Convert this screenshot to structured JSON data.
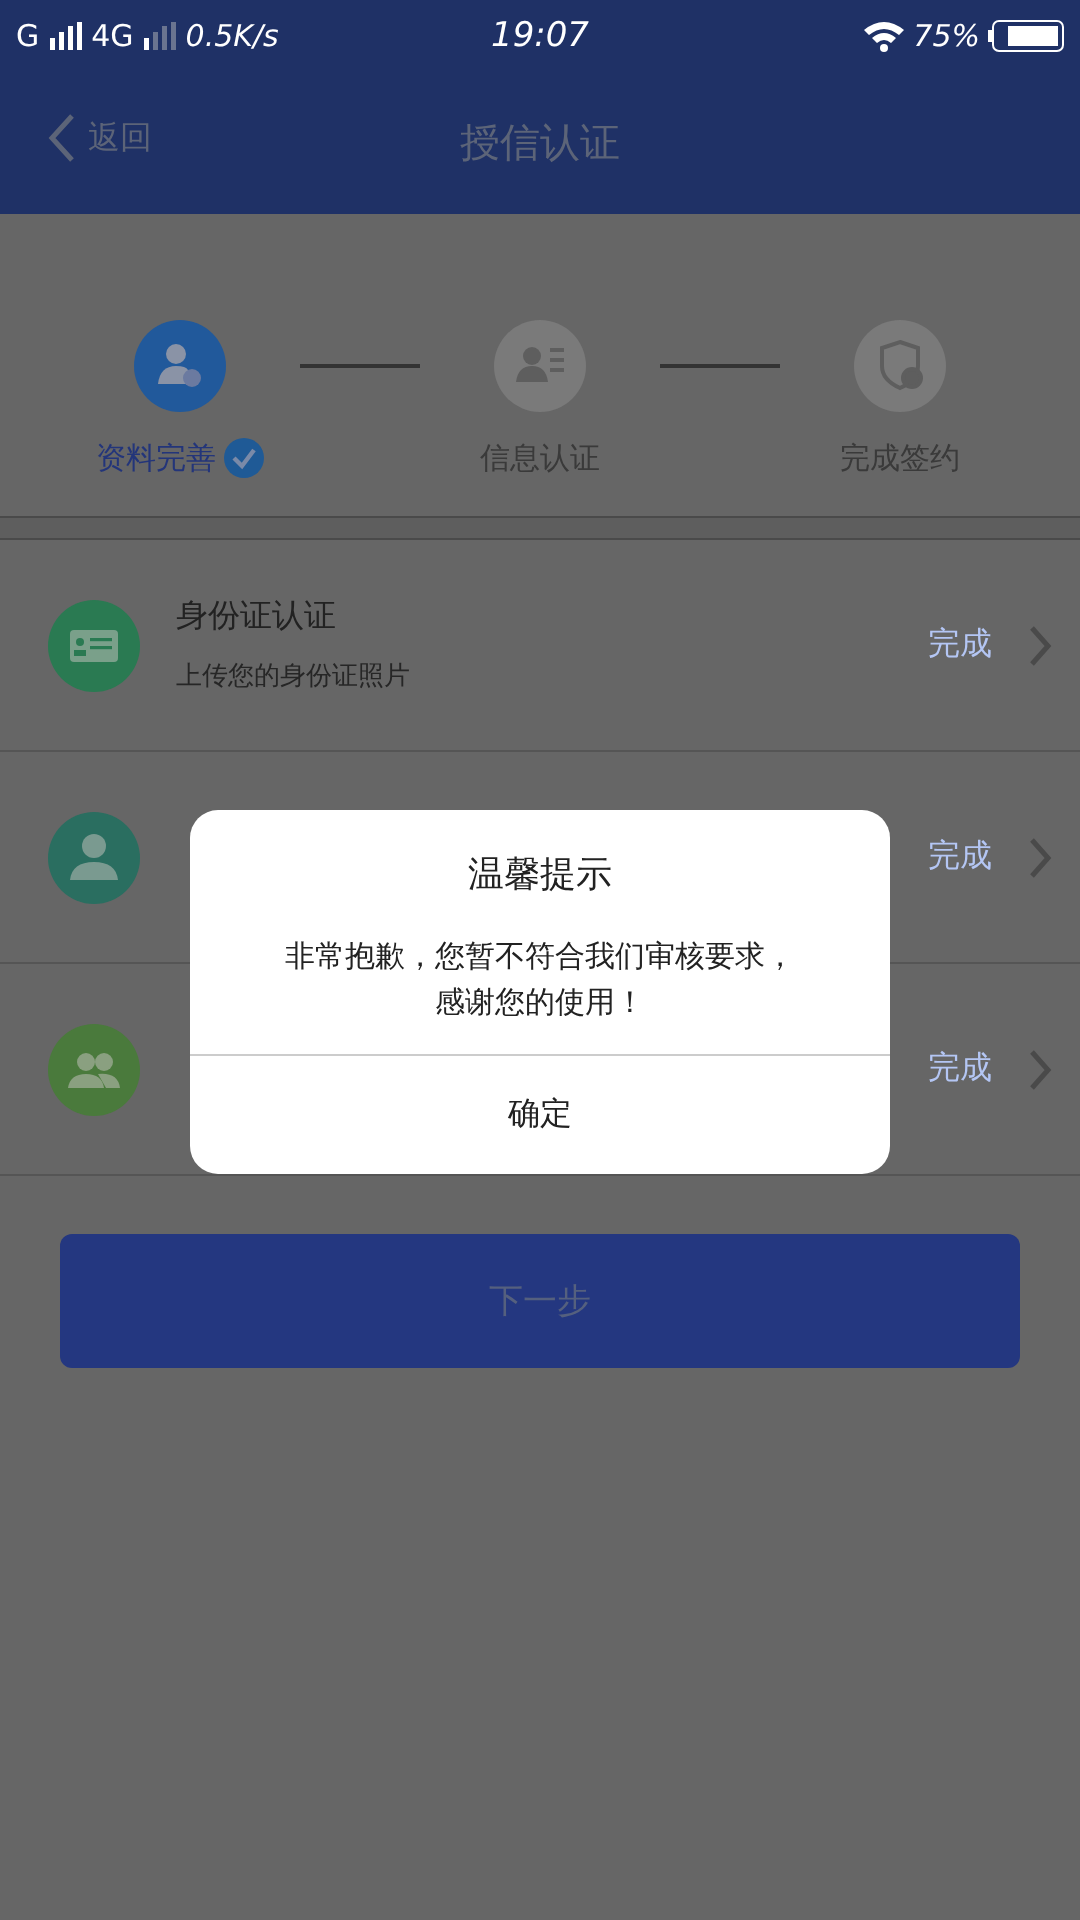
{
  "status_bar": {
    "network_1": "G",
    "network_2": "4G",
    "speed": "0.5K/s",
    "time": "19:07",
    "battery": "75%"
  },
  "header": {
    "back": "返回",
    "title": "授信认证"
  },
  "steps": [
    {
      "label": "资料完善",
      "kind": "profile",
      "completed": true
    },
    {
      "label": "信息认证",
      "kind": "id-card",
      "completed": false
    },
    {
      "label": "完成签约",
      "kind": "shield",
      "completed": false
    }
  ],
  "items": [
    {
      "title": "身份证认证",
      "subtitle": "上传您的身份证照片",
      "status": "完成",
      "kind": "id-card",
      "color": "#2a7a52"
    },
    {
      "status": "完成",
      "kind": "person",
      "color": "#2a6e60"
    },
    {
      "status": "完成",
      "kind": "people",
      "color": "#4a7a3c"
    }
  ],
  "next_button": "下一步",
  "dialog": {
    "title": "温馨提示",
    "message_lines": [
      "非常抱歉，您暂不符合我们审核要求，",
      "感谢您的使用！"
    ],
    "button": "确定"
  }
}
